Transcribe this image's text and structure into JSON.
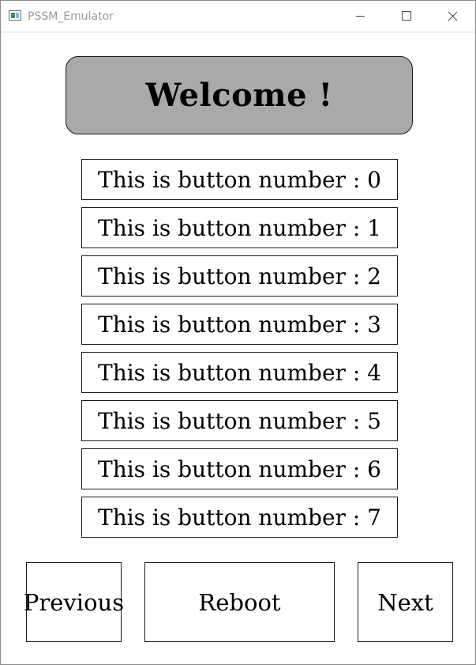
{
  "window": {
    "title": "PSSM_Emulator",
    "app_icon": "app-window-icon",
    "controls": [
      "minimize-icon",
      "maximize-icon",
      "close-icon"
    ]
  },
  "header": {
    "welcome_text": "Welcome !",
    "background_color": "#a9a9a9"
  },
  "buttons": [
    {
      "label": "This is button number : 0"
    },
    {
      "label": "This is button number : 1"
    },
    {
      "label": "This is button number : 2"
    },
    {
      "label": "This is button number : 3"
    },
    {
      "label": "This is button number : 4"
    },
    {
      "label": "This is button number : 5"
    },
    {
      "label": "This is button number : 6"
    },
    {
      "label": "This is button number : 7"
    }
  ],
  "navigation": {
    "previous_label": "Previous",
    "reboot_label": "Reboot",
    "next_label": "Next"
  }
}
